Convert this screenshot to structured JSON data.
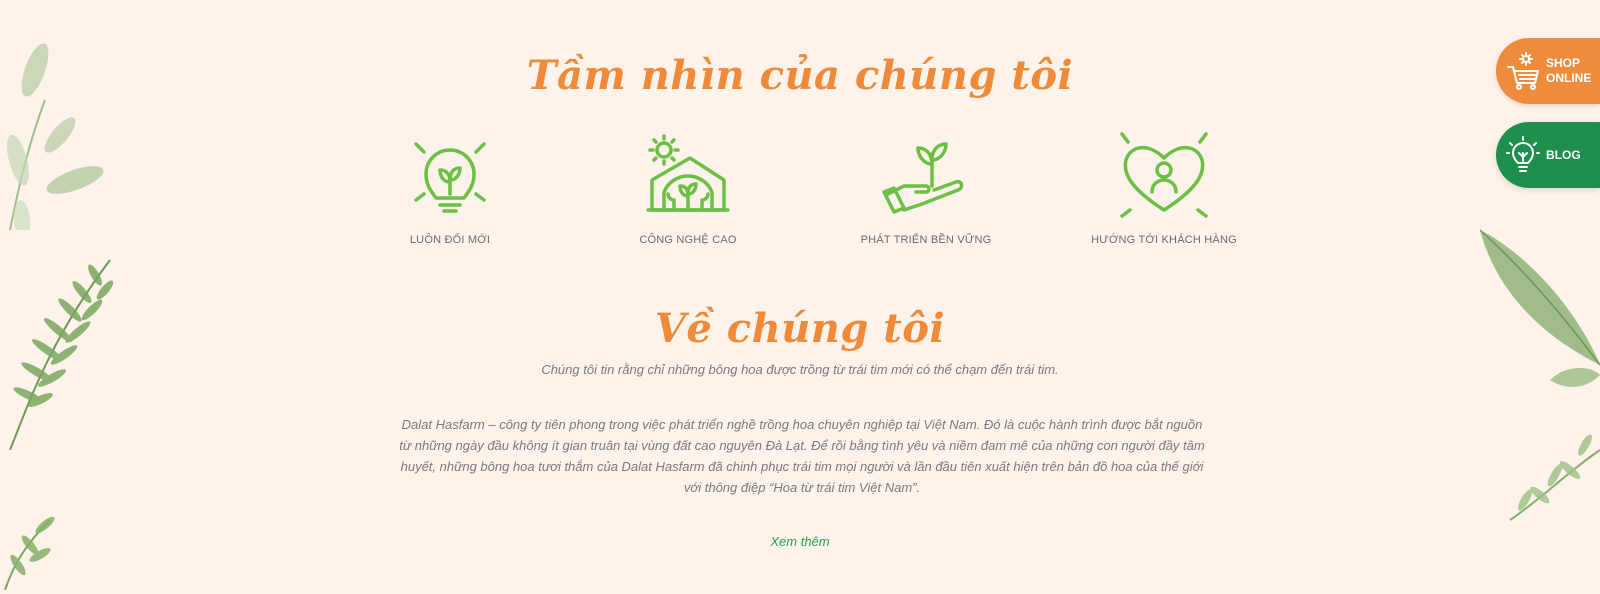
{
  "vision": {
    "title": "Tầm nhìn của chúng tôi",
    "features": [
      {
        "label": "LUÔN ĐỔI MỚI",
        "icon": "lightbulb-plant-icon"
      },
      {
        "label": "CÔNG NGHỆ CAO",
        "icon": "greenhouse-icon"
      },
      {
        "label": "PHÁT TRIỂN BỀN VỮNG",
        "icon": "hand-sprout-icon"
      },
      {
        "label": "HƯỚNG TỚI KHÁCH HÀNG",
        "icon": "heart-person-icon"
      }
    ]
  },
  "about": {
    "title": "Về chúng tôi",
    "tagline": "Chúng tôi tin rằng chỉ những bông hoa được trồng từ trái tim mới có thể chạm đến trái tim.",
    "body": "Dalat Hasfarm – công ty tiên phong trong việc phát triển nghề trồng hoa chuyên nghiệp tại Việt Nam. Đó là cuộc hành trình được bắt nguồn từ những ngày đầu không ít gian truân tại vùng đất cao nguyên Đà Lạt. Để rồi bằng tình yêu và niềm đam mê của những con người đầy tâm huyết, những bông hoa tươi thắm của Dalat Hasfarm đã chinh phục trái tim mọi người và lần đầu tiên xuất hiện trên bản đồ hoa của thế giới với thông điệp “Hoa từ trái tim Việt Nam”.",
    "read_more": "Xem thêm"
  },
  "side_buttons": {
    "shop": {
      "line1": "SHOP",
      "line2": "ONLINE",
      "icon": "flower-cart-icon"
    },
    "blog": {
      "label": "BLOG",
      "icon": "lightbulb-icon"
    }
  },
  "colors": {
    "background": "#fdf3ea",
    "heading": "#ee8a3a",
    "icon_green": "#6cbf45",
    "link_green": "#2aa14d",
    "shop_button": "#ef8c3c",
    "blog_button": "#1f8f4e"
  }
}
